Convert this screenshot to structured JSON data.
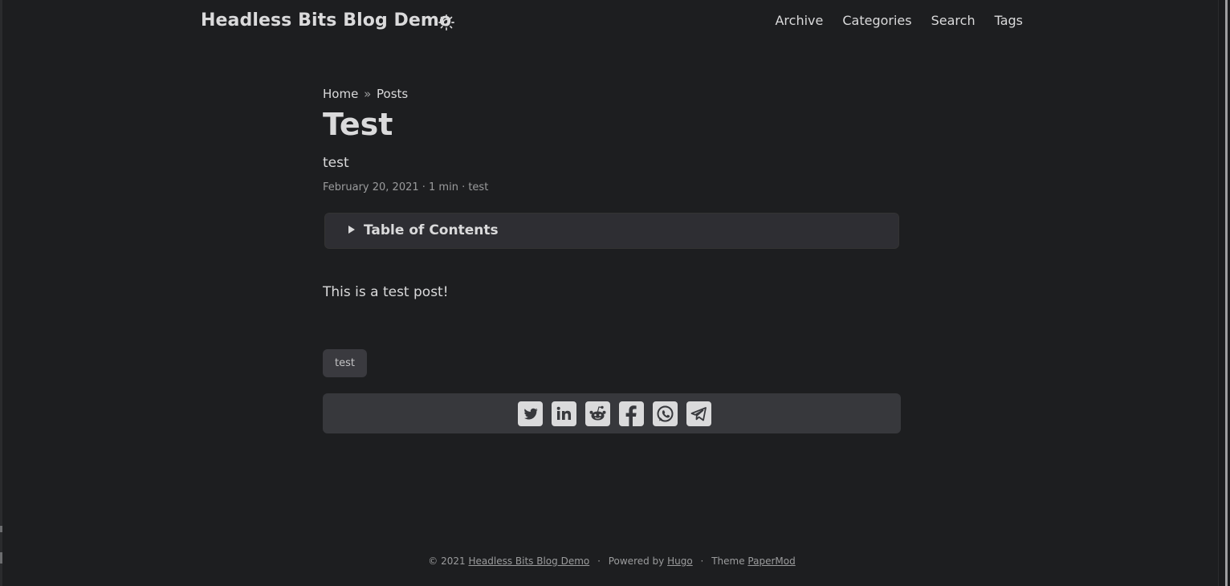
{
  "header": {
    "site_title": "Headless Bits Blog Demo",
    "theme_toggle_icon": "sun-icon",
    "menu": [
      {
        "label": "Archive"
      },
      {
        "label": "Categories"
      },
      {
        "label": "Search"
      },
      {
        "label": "Tags"
      }
    ]
  },
  "post": {
    "breadcrumbs": {
      "home": "Home",
      "separator": "»",
      "section": "Posts"
    },
    "title": "Test",
    "description": "test",
    "meta": "February 20, 2021 · 1 min · test",
    "toc_label": "Table of Contents",
    "content": "This is a test post!",
    "tags": [
      "test"
    ],
    "share_icons": [
      "twitter-icon",
      "linkedin-icon",
      "reddit-icon",
      "facebook-icon",
      "whatsapp-icon",
      "telegram-icon"
    ]
  },
  "footer": {
    "copyright": "© 2021",
    "site_link": "Headless Bits Blog Demo",
    "powered_by": "Powered by",
    "hugo": "Hugo",
    "theme_text": "Theme",
    "theme_link": "PaperMod",
    "separator": "·"
  },
  "colors": {
    "background": "#1d1e20",
    "text": "#dadadb",
    "secondary": "#9b9c9d",
    "card": "#37383c"
  }
}
